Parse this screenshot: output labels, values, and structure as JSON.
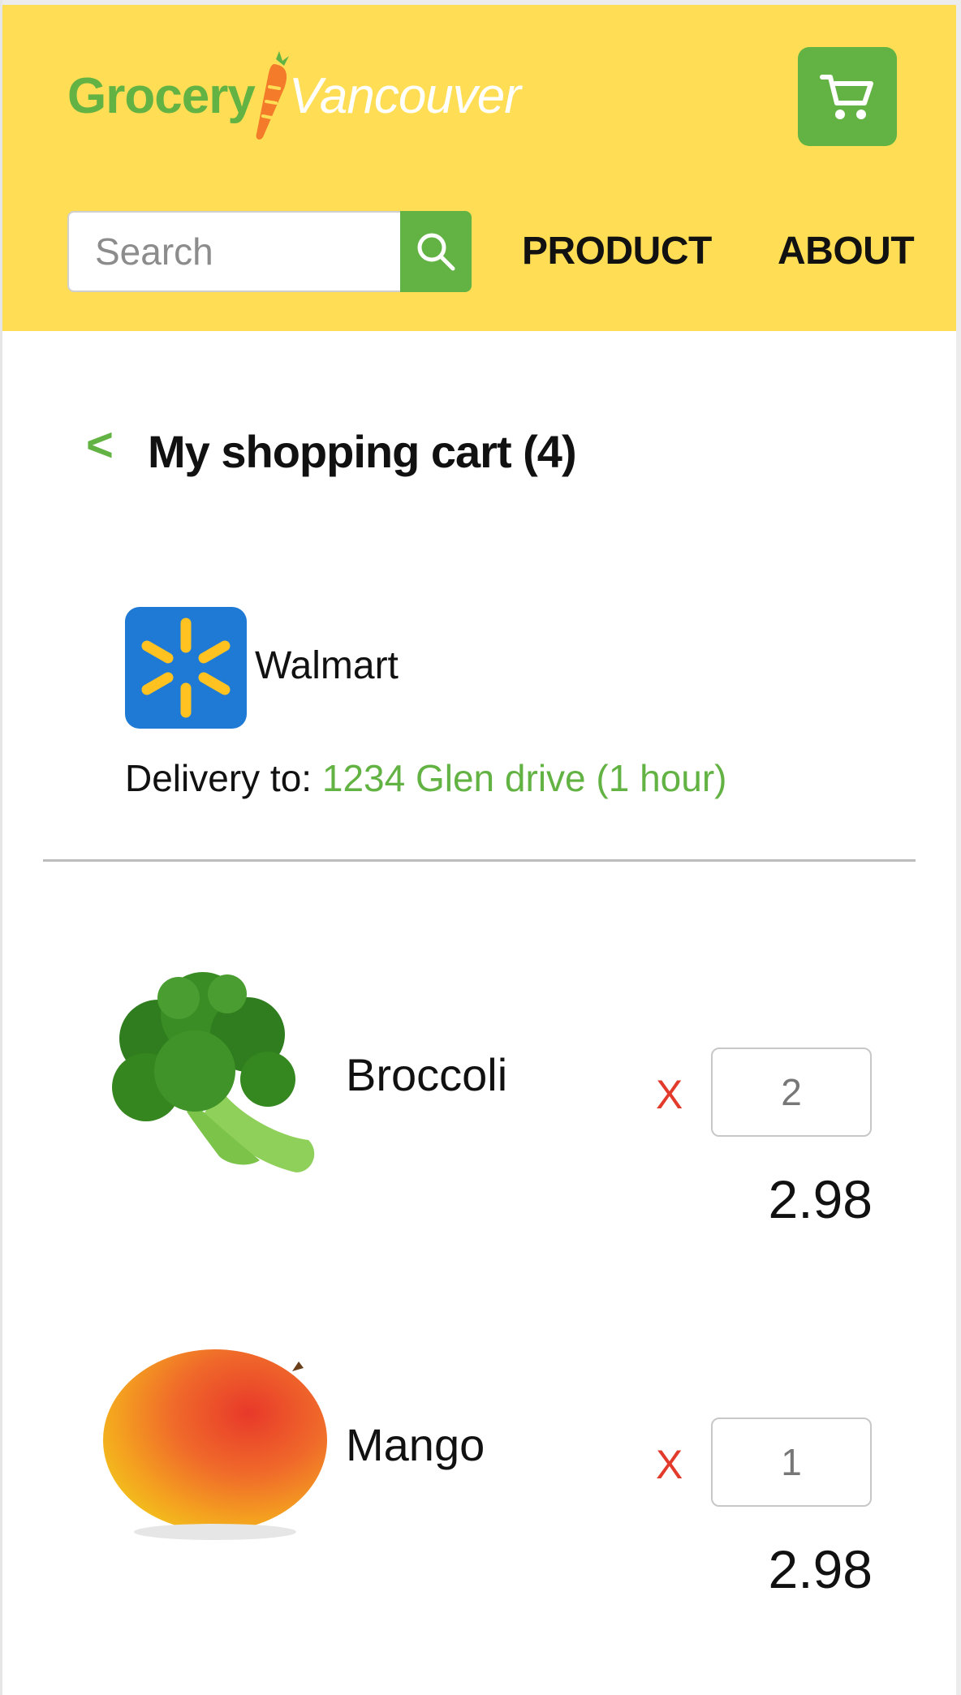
{
  "header": {
    "logo_left": "Grocery",
    "logo_right": "Vancouver",
    "cart_icon": "shopping-cart-icon",
    "search": {
      "placeholder": "Search",
      "value": ""
    },
    "search_icon": "search-icon",
    "nav": [
      {
        "label": "PRODUCT"
      },
      {
        "label": "ABOUT"
      }
    ]
  },
  "cart": {
    "back_label": "<",
    "title": "My shopping cart (4)"
  },
  "store": {
    "name": "Walmart",
    "delivery_label": "Delivery to: ",
    "delivery_address": "1234 Glen drive (1 hour)"
  },
  "items": [
    {
      "name": "Broccoli",
      "remove": "X",
      "quantity": "2",
      "price": "2.98",
      "image": "broccoli-image"
    },
    {
      "name": "Mango",
      "remove": "X",
      "quantity": "1",
      "price": "2.98",
      "image": "mango-image"
    }
  ],
  "colors": {
    "header_bg": "#ffde55",
    "brand_green": "#63b344",
    "remove_red": "#e23b2b",
    "walmart_blue": "#1f7ad6",
    "walmart_yellow": "#ffc220"
  }
}
